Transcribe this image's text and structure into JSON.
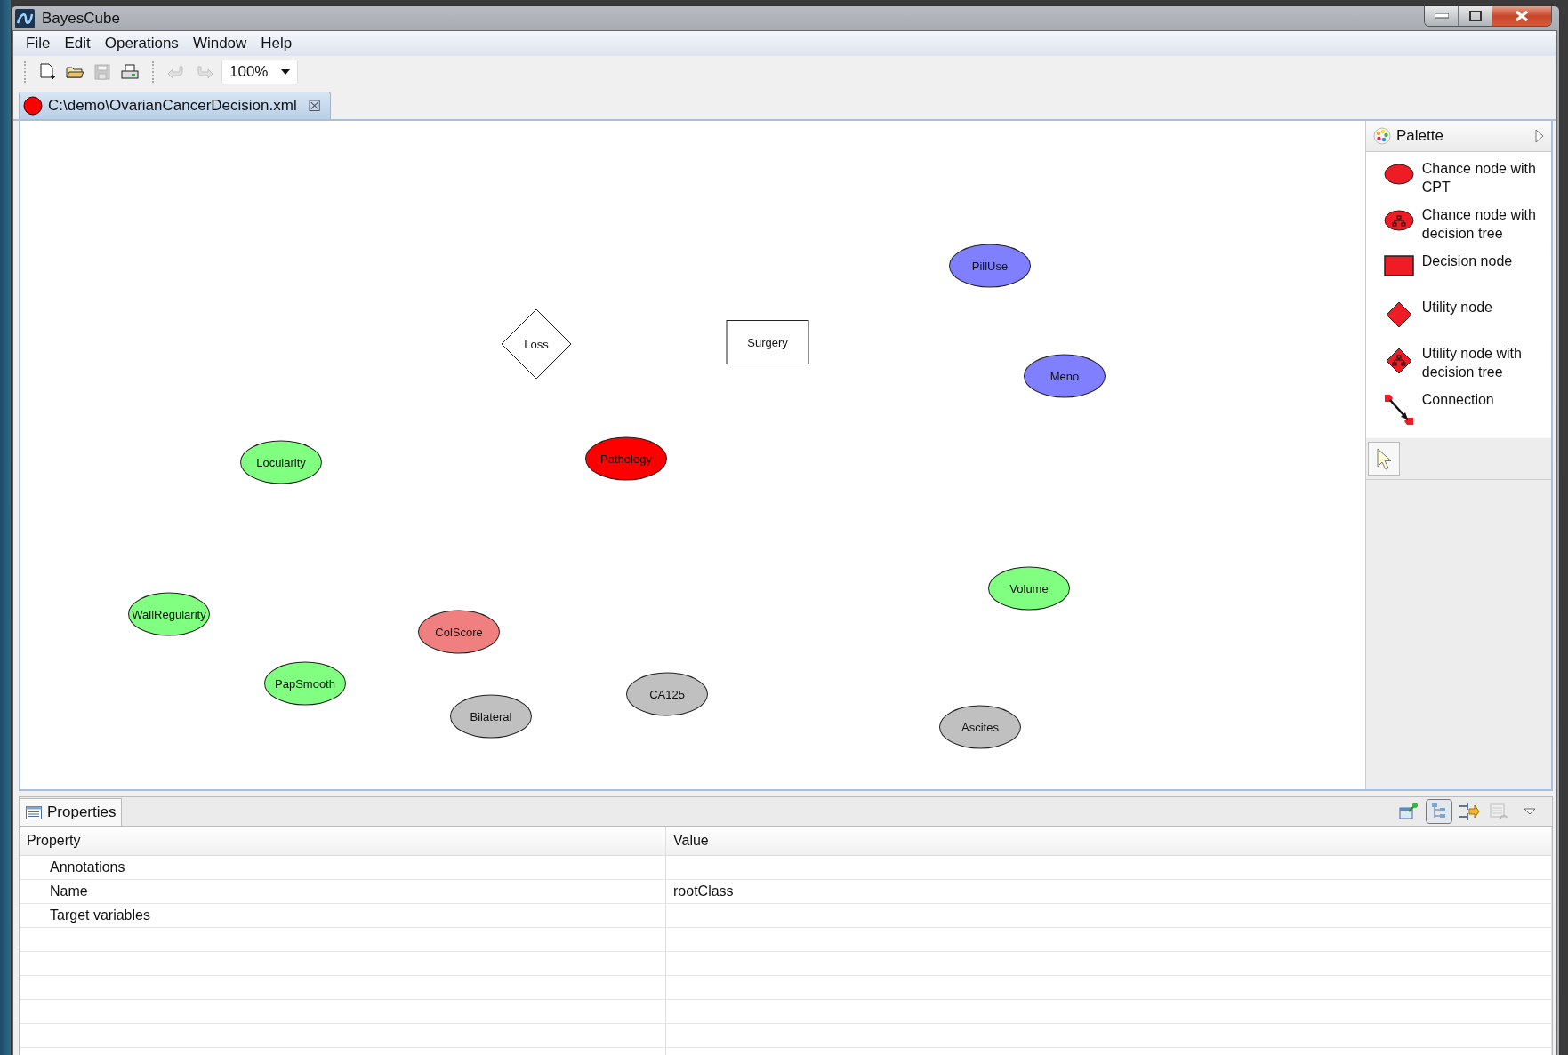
{
  "window": {
    "title": "BayesCube"
  },
  "menu": [
    "File",
    "Edit",
    "Operations",
    "Window",
    "Help"
  ],
  "toolbar": {
    "buttons": [
      {
        "kind": "new",
        "disabled": false
      },
      {
        "kind": "open",
        "disabled": false
      },
      {
        "kind": "save",
        "disabled": true
      },
      {
        "kind": "print",
        "disabled": false
      },
      {
        "kind": "undo",
        "disabled": true
      },
      {
        "kind": "redo",
        "disabled": true
      }
    ],
    "zoom": "100%"
  },
  "editor_tab": {
    "label": "C:\\demo\\OvarianCancerDecision.xml",
    "close": "☒"
  },
  "nodes": [
    {
      "label": "PillUse",
      "kind": "chance",
      "color": "#8080ff"
    },
    {
      "label": "Loss",
      "kind": "utility",
      "color": "#ffffff"
    },
    {
      "label": "Surgery",
      "kind": "decision",
      "color": "#ffffff"
    },
    {
      "label": "Meno",
      "kind": "chance",
      "color": "#8080ff"
    },
    {
      "label": "Locularity",
      "kind": "chance",
      "color": "#80ff80"
    },
    {
      "label": "Pathology",
      "kind": "chance",
      "color": "#ff0000"
    },
    {
      "label": "Volume",
      "kind": "chance",
      "color": "#80ff80"
    },
    {
      "label": "WallRegularity",
      "kind": "chance",
      "color": "#80ff80"
    },
    {
      "label": "ColScore",
      "kind": "chance",
      "color": "#f08080"
    },
    {
      "label": "PapSmooth",
      "kind": "chance",
      "color": "#80ff80"
    },
    {
      "label": "CA125",
      "kind": "chance",
      "color": "#c0c0c0"
    },
    {
      "label": "Bilateral",
      "kind": "chance",
      "color": "#c0c0c0"
    },
    {
      "label": "Ascites",
      "kind": "chance",
      "color": "#c0c0c0"
    }
  ],
  "palette": {
    "title": "Palette",
    "items": [
      {
        "label": "Chance node with CPT",
        "kind": "chance"
      },
      {
        "label": "Chance node with decision tree",
        "kind": "chance-tree"
      },
      {
        "label": "Decision node",
        "kind": "decision"
      },
      {
        "label": "Utility node",
        "kind": "utility"
      },
      {
        "label": "Utility node with decision tree",
        "kind": "utility-tree"
      },
      {
        "label": "Connection",
        "kind": "connection"
      }
    ],
    "tools": [
      {
        "kind": "select",
        "selected": true
      }
    ]
  },
  "properties": {
    "title": "Properties",
    "view_buttons": [
      {
        "kind": "pin",
        "selected": false
      },
      {
        "kind": "tree",
        "selected": true
      },
      {
        "kind": "filter",
        "selected": false
      },
      {
        "kind": "restore",
        "selected": false
      }
    ],
    "columns": [
      "Property",
      "Value"
    ],
    "rows": [
      {
        "property": "Annotations"
      },
      {
        "property": "Name",
        "value": "rootClass"
      },
      {
        "property": "Target variables"
      }
    ]
  }
}
